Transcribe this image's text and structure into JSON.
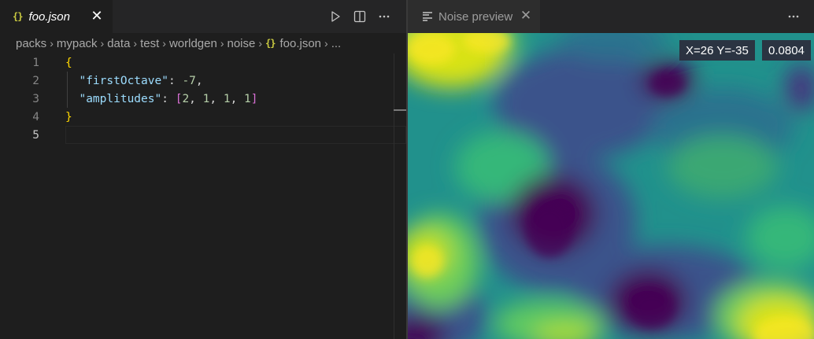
{
  "left_editor": {
    "tab": {
      "icon": "json-braces-icon",
      "icon_glyph": "{}",
      "title": "foo.json",
      "close": "✕"
    },
    "actions": [
      "run-icon",
      "split-editor-icon",
      "more-actions-icon"
    ],
    "breadcrumb": {
      "items": [
        "packs",
        "mypack",
        "data",
        "test",
        "worldgen",
        "noise"
      ],
      "file_glyph": "{}",
      "file": "foo.json",
      "ellipsis": "..."
    },
    "line_numbers": [
      "1",
      "2",
      "3",
      "4",
      "5"
    ],
    "code": {
      "open_brace": "{",
      "key1": "\"firstOctave\"",
      "sep1": ": ",
      "val1": "-7",
      "comma": ",",
      "key2": "\"amplitudes\"",
      "sep2": ": ",
      "lbracket": "[",
      "amp_values": [
        "2",
        "1",
        "1",
        "1"
      ],
      "amp_sep": ", ",
      "rbracket": "]",
      "close_brace": "}"
    }
  },
  "right_preview": {
    "tab": {
      "icon": "preview-icon",
      "title": "Noise preview",
      "close": "✕"
    },
    "actions": [
      "more-actions-icon"
    ],
    "coords_label": "X=26 Y=-35",
    "value_label": "0.0804",
    "colormap": [
      "#440154",
      "#3b528b",
      "#21918c",
      "#5ec962",
      "#fde725"
    ]
  }
}
